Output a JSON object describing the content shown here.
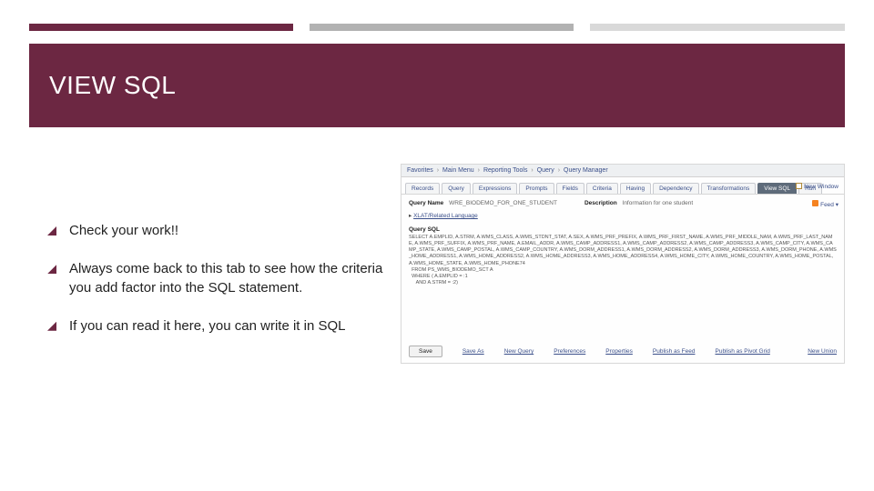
{
  "accent": {
    "seg1_color": "#6c2742",
    "seg2_color": "#b2b2b2",
    "seg3_color": "#d9d9d9"
  },
  "title": "VIEW SQL",
  "bullets": [
    "Check your work!!",
    "Always come back to this tab to see how the criteria you add factor into the SQL statement.",
    "If you can read it here, you can write it in SQL"
  ],
  "screenshot": {
    "breadcrumb": [
      "Favorites",
      "Main Menu",
      "Reporting Tools",
      "Query",
      "Query Manager"
    ],
    "tabs": [
      "Records",
      "Query",
      "Expressions",
      "Prompts",
      "Fields",
      "Criteria",
      "Having",
      "Dependency",
      "Transformations",
      "View SQL",
      "Run"
    ],
    "active_tab": "View SQL",
    "new_window": "New Window",
    "query_name_label": "Query Name",
    "query_name_value": "WRE_BIODEMO_FOR_ONE_STUDENT",
    "description_label": "Description",
    "description_value": "Information for one student",
    "feed_label": "Feed",
    "xlat_label": "XLAT/Related Language",
    "query_sql_label": "Query SQL",
    "sql_text": "SELECT A.EMPLID, A.STRM, A.WMS_CLASS, A.WMS_STDNT_STAT, A.SEX, A.WMS_PRF_PREFIX, A.WMS_PRF_FIRST_NAME, A.WMS_PRF_MIDDLE_NAM, A.WMS_PRF_LAST_NAME, A.WMS_PRF_SUFFIX, A.WMS_PRF_NAME, A.EMAIL_ADDR, A.WMS_CAMP_ADDRESS1, A.WMS_CAMP_ADDRESS2, A.WMS_CAMP_ADDRESS3, A.WMS_CAMP_CITY, A.WMS_CAMP_STATE, A.WMS_CAMP_POSTAL, A.WMS_CAMP_COUNTRY, A.WMS_DORM_ADDRESS1, A.WMS_DORM_ADDRESS2, A.WMS_DORM_ADDRESS3, A.WMS_DORM_PHONE, A.WMS_HOME_ADDRESS1, A.WMS_HOME_ADDRESS2, A.WMS_HOME_ADDRESS3, A.WMS_HOME_ADDRESS4, A.WMS_HOME_CITY, A.WMS_HOME_COUNTRY, A.WMS_HOME_POSTAL, A.WMS_HOME_STATE, A.WMS_HOME_PHONE74\n  FROM PS_WMS_BIODEMO_SCT A\n  WHERE ( A.EMPLID = :1\n     AND A.STRM = :2)",
    "save_label": "Save",
    "links": [
      "Save As",
      "New Query",
      "Preferences",
      "Properties",
      "Publish as Feed",
      "Publish as Pivot Grid"
    ],
    "new_union": "New Union"
  }
}
